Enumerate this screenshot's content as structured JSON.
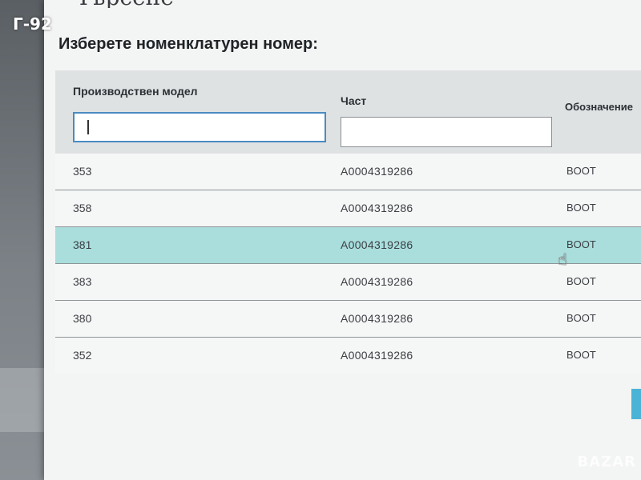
{
  "watermark": {
    "tag": "Г-92",
    "brand": "BAZAR"
  },
  "dialog": {
    "title": "Търсене",
    "subtitle": "Изберете номенклатурен номер:"
  },
  "columns": {
    "model": "Производствен модел",
    "part": "Част",
    "designation": "Обозначение"
  },
  "filters": {
    "model_value": "",
    "part_value": ""
  },
  "rows": [
    {
      "model": "353",
      "part": "A0004319286",
      "designation": "BOOT",
      "selected": false
    },
    {
      "model": "358",
      "part": "A0004319286",
      "designation": "BOOT",
      "selected": false
    },
    {
      "model": "381",
      "part": "A0004319286",
      "designation": "BOOT",
      "selected": true
    },
    {
      "model": "383",
      "part": "A0004319286",
      "designation": "BOOT",
      "selected": false
    },
    {
      "model": "380",
      "part": "A0004319286",
      "designation": "BOOT",
      "selected": false
    },
    {
      "model": "352",
      "part": "A0004319286",
      "designation": "BOOT",
      "selected": false
    }
  ],
  "colors": {
    "selected_row": "#a9dedd",
    "focus_border": "#4a8bc2",
    "accent_button": "#4ab3d6"
  },
  "icons": {
    "cursor": "hand-pointer-icon"
  }
}
